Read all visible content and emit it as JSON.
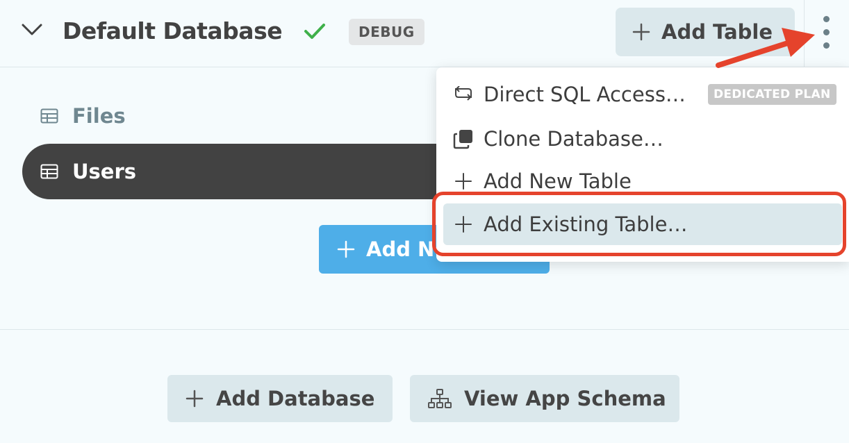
{
  "header": {
    "database_name": "Default Database",
    "debug_badge": "DEBUG",
    "add_table_label": "Add Table"
  },
  "tables": [
    {
      "name": "Files",
      "selected": false
    },
    {
      "name": "Users",
      "selected": true
    }
  ],
  "add_new_button_label": "Add New Table",
  "menu": {
    "items": [
      {
        "label": "Direct SQL Access…",
        "icon": "sql-access-icon",
        "badge": "DEDICATED PLAN"
      },
      {
        "label": "Clone Database…",
        "icon": "clone-icon"
      },
      {
        "label": "Add New Table",
        "icon": "plus-icon"
      },
      {
        "label": "Add Existing Table…",
        "icon": "plus-icon",
        "highlighted": true
      }
    ]
  },
  "footer": {
    "add_database_label": "Add Database",
    "view_schema_label": "View App Schema"
  },
  "colors": {
    "background": "#f5fbfd",
    "button_bg": "#dbe8ec",
    "primary_blue": "#4eaee8",
    "selected_row": "#424242",
    "check_green": "#3fb04a",
    "annotation_red": "#e5432c"
  }
}
